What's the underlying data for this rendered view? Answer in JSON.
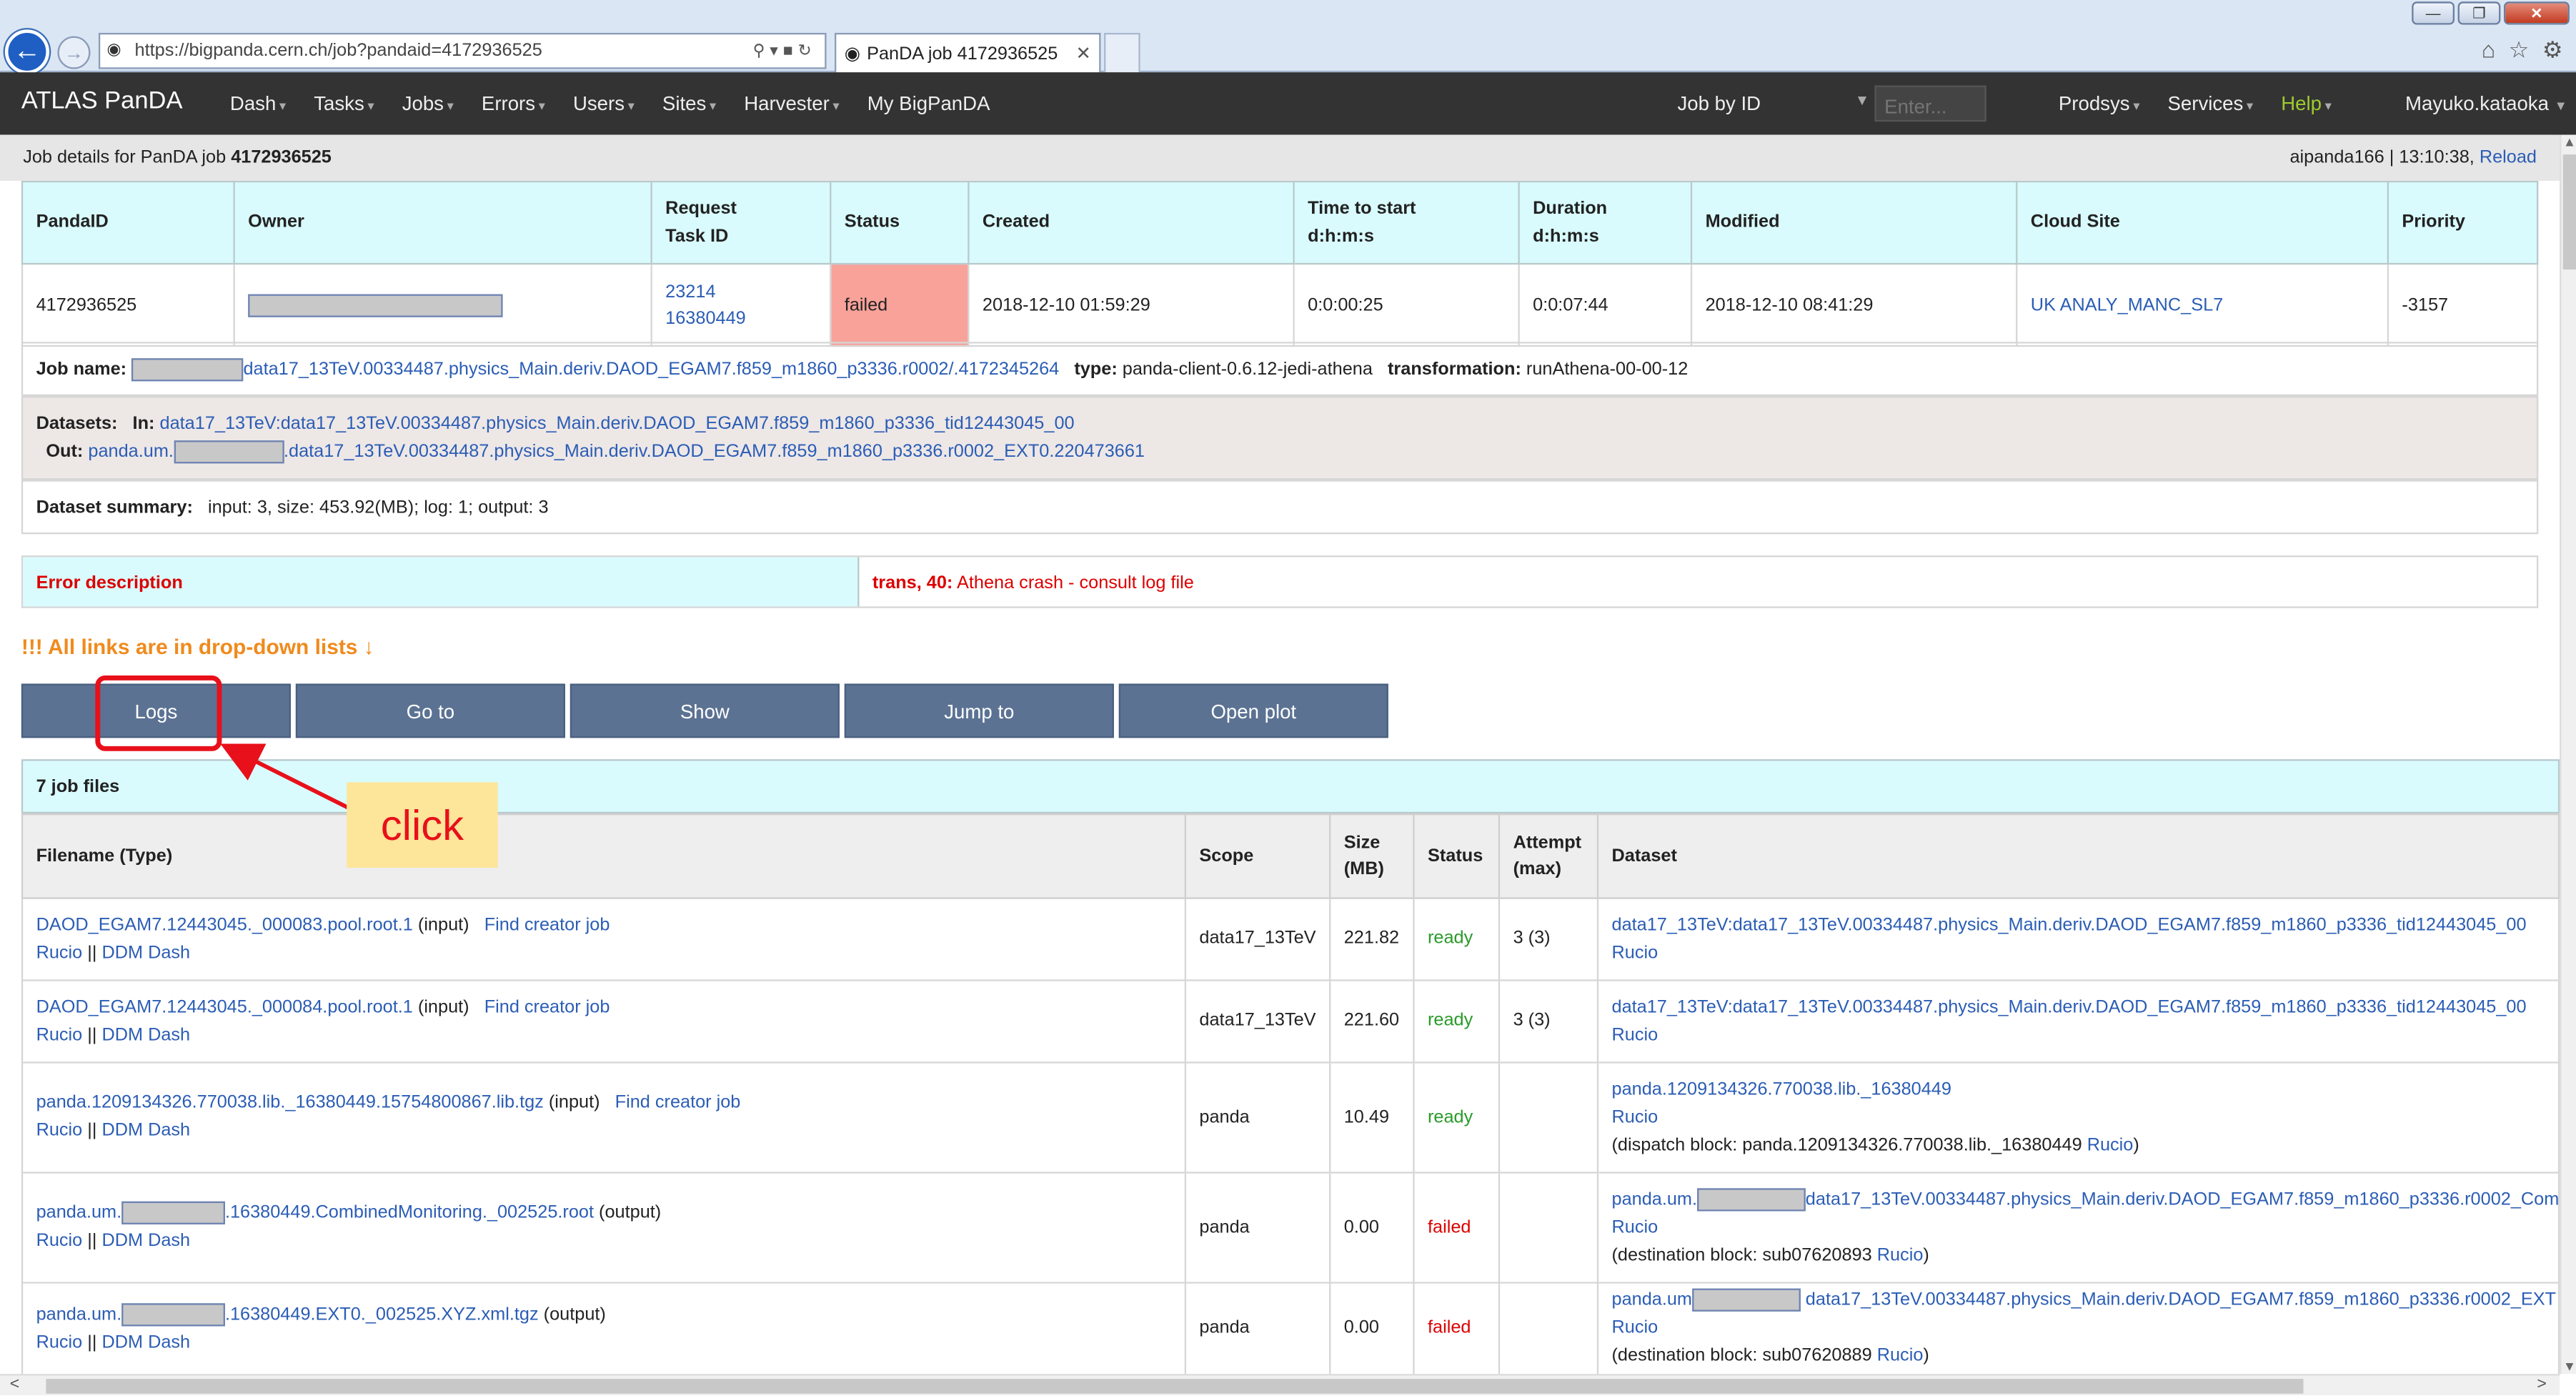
{
  "browser": {
    "url": "https://bigpanda.cern.ch/job?pandaid=4172936525",
    "tab_title": "PanDA job 4172936525"
  },
  "nav": {
    "brand": "ATLAS PanDA",
    "menu": [
      "Dash",
      "Tasks",
      "Jobs",
      "Errors",
      "Users",
      "Sites",
      "Harvester"
    ],
    "mybigpanda": "My BigPanDA",
    "jobid_label": "Job by ID",
    "jobid_placeholder": "Enter...",
    "right_menu": [
      "Prodsys",
      "Services",
      "Help"
    ],
    "user": "Mayuko.kataoka"
  },
  "subheader": {
    "prefix": "Job details for PanDA job ",
    "jobid": "4172936525",
    "server_time": "aipanda166 | 13:10:38, ",
    "reload": "Reload"
  },
  "job": {
    "headers": {
      "pandaid": "PandaID",
      "owner": "Owner",
      "request_1": "Request",
      "request_2": "Task ID",
      "status": "Status",
      "created": "Created",
      "tts_1": "Time to start",
      "tts_2": "d:h:m:s",
      "dur_1": "Duration",
      "dur_2": "d:h:m:s",
      "modified": "Modified",
      "cloud": "Cloud Site",
      "priority": "Priority"
    },
    "row": {
      "pandaid": "4172936525",
      "request_id": "23214",
      "task_id": "16380449",
      "status": "failed",
      "created": "2018-12-10 01:59:29",
      "time_to_start": "0:0:00:25",
      "duration": "0:0:07:44",
      "modified": "2018-12-10 08:41:29",
      "cloud_site": "UK ANALY_MANC_SL7",
      "priority": "-3157"
    },
    "name_label": "Job name:",
    "name_value": "data17_13TeV.00334487.physics_Main.deriv.DAOD_EGAM7.f859_m1860_p3336.r0002/.4172345264",
    "type_label": "type:",
    "type_value": "panda-client-0.6.12-jedi-athena",
    "trans_label": "transformation:",
    "trans_value": "runAthena-00-00-12",
    "datasets_label": "Datasets:",
    "in_label": "In:",
    "in_value": "data17_13TeV:data17_13TeV.00334487.physics_Main.deriv.DAOD_EGAM7.f859_m1860_p3336_tid12443045_00",
    "out_label": "Out:",
    "out_prefix": "panda.um.",
    "out_value": ".data17_13TeV.00334487.physics_Main.deriv.DAOD_EGAM7.f859_m1860_p3336.r0002_EXT0.220473661",
    "summary_label": "Dataset summary:",
    "summary_value": "input: 3, size: 453.92(MB); log: 1; output: 3"
  },
  "error": {
    "label": "Error description",
    "code": "trans, 40:",
    "message": " Athena crash - consult log file"
  },
  "warning": "!!! All links are in drop-down lists ↓",
  "buttons": [
    "Logs",
    "Go to",
    "Show",
    "Jump to",
    "Open plot"
  ],
  "callout": "click",
  "files": {
    "title": "7 job files",
    "headers": {
      "filename": "Filename (Type)",
      "scope": "Scope",
      "size_1": "Size",
      "size_2": "(MB)",
      "status": "Status",
      "attempt_1": "Attempt",
      "attempt_2": "(max)",
      "dataset": "Dataset"
    },
    "rucio": "Rucio",
    "ddm": "DDM Dash",
    "find_creator": "Find creator job",
    "rows": [
      {
        "name": "DAOD_EGAM7.12443045._000083.pool.root.1",
        "type": "(input)",
        "scope": "data17_13TeV",
        "size": "221.82",
        "status": "ready",
        "attempt": "3 (3)",
        "dataset": "data17_13TeV:data17_13TeV.00334487.physics_Main.deriv.DAOD_EGAM7.f859_m1860_p3336_tid12443045_00"
      },
      {
        "name": "DAOD_EGAM7.12443045._000084.pool.root.1",
        "type": "(input)",
        "scope": "data17_13TeV",
        "size": "221.60",
        "status": "ready",
        "attempt": "3 (3)",
        "dataset": "data17_13TeV:data17_13TeV.00334487.physics_Main.deriv.DAOD_EGAM7.f859_m1860_p3336_tid12443045_00"
      },
      {
        "name": "panda.1209134326.770038.lib._16380449.15754800867.lib.tgz",
        "type": "(input)",
        "scope": "panda",
        "size": "10.49",
        "status": "ready",
        "attempt": "",
        "dataset": "panda.1209134326.770038.lib._16380449",
        "block_prefix": "(dispatch block: panda.1209134326.770038.lib._16380449 ",
        "block_suffix": ")"
      },
      {
        "name_prefix": "panda.um.",
        "name": ".16380449.CombinedMonitoring._002525.root",
        "type": "(output)",
        "scope": "panda",
        "size": "0.00",
        "status": "failed",
        "attempt": "",
        "dataset_prefix": "panda.um.",
        "dataset": "data17_13TeV.00334487.physics_Main.deriv.DAOD_EGAM7.f859_m1860_p3336.r0002_Com",
        "block_prefix": "(destination block: sub07620893 ",
        "block_suffix": ")"
      },
      {
        "name_prefix": "panda.um.",
        "name": ".16380449.EXT0._002525.XYZ.xml.tgz",
        "type": "(output)",
        "scope": "panda",
        "size": "0.00",
        "status": "failed",
        "attempt": "",
        "dataset_prefix": "panda.um",
        "dataset": " data17_13TeV.00334487.physics_Main.deriv.DAOD_EGAM7.f859_m1860_p3336.r0002_EXT",
        "block_prefix": "(destination block: sub07620889 ",
        "block_suffix": ")"
      }
    ]
  },
  "colors": {
    "navbar": "#333333",
    "header_cyan": "#d9fbfd",
    "failed_bg": "#f8a29a",
    "button": "#5b7293",
    "highlight": "#e8101a",
    "callout_bg": "#fde59a",
    "link": "#2b5db5"
  }
}
